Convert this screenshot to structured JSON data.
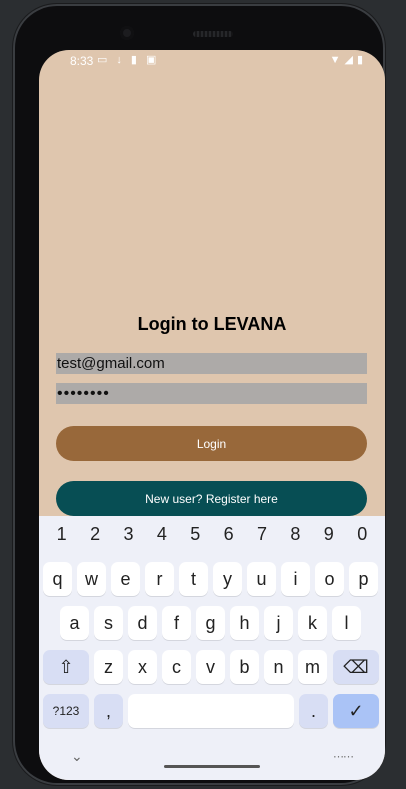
{
  "status_bar": {
    "time": "8:33",
    "icons": [
      "screen-icon",
      "download-icon",
      "sd-card-icon",
      "notification-icon"
    ],
    "right_icons": [
      "wifi-icon",
      "signal-icon",
      "battery-icon"
    ]
  },
  "login": {
    "title": "Login to LEVANA",
    "email_value": "test@gmail.com",
    "password_value": "••••••••",
    "login_label": "Login",
    "register_label": "New user? Register here"
  },
  "keyboard": {
    "numbers": [
      "1",
      "2",
      "3",
      "4",
      "5",
      "6",
      "7",
      "8",
      "9",
      "0"
    ],
    "row1": [
      "q",
      "w",
      "e",
      "r",
      "t",
      "y",
      "u",
      "i",
      "o",
      "p"
    ],
    "row2": [
      "a",
      "s",
      "d",
      "f",
      "g",
      "h",
      "j",
      "k",
      "l"
    ],
    "row3": [
      "z",
      "x",
      "c",
      "v",
      "b",
      "n",
      "m"
    ],
    "symbols_label": "?123",
    "comma": ",",
    "period": ".",
    "shift_icon": "shift-icon",
    "backspace_icon": "backspace-icon",
    "enter_icon": "checkmark-icon"
  },
  "colors": {
    "screen_bg": "#dfc6ae",
    "login_button": "#98683a",
    "register_button": "#074e54",
    "field_bg": "#adaaa8"
  }
}
